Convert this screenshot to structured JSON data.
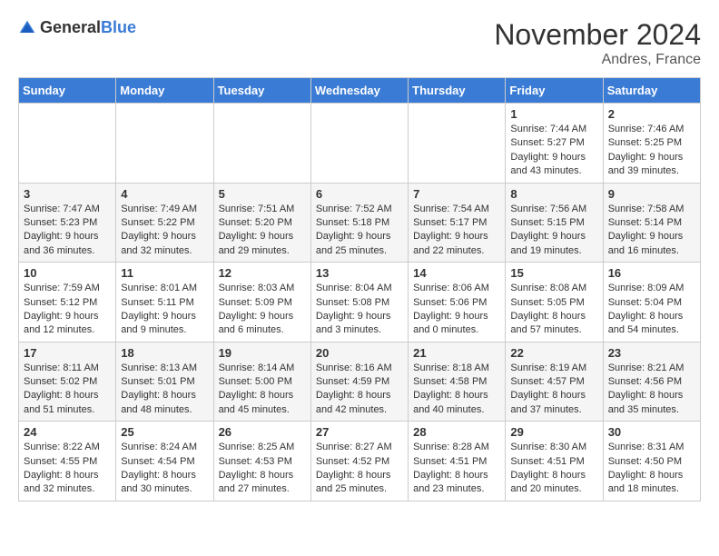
{
  "header": {
    "logo_general": "General",
    "logo_blue": "Blue",
    "month": "November 2024",
    "location": "Andres, France"
  },
  "days_of_week": [
    "Sunday",
    "Monday",
    "Tuesday",
    "Wednesday",
    "Thursday",
    "Friday",
    "Saturday"
  ],
  "weeks": [
    [
      {
        "day": "",
        "info": ""
      },
      {
        "day": "",
        "info": ""
      },
      {
        "day": "",
        "info": ""
      },
      {
        "day": "",
        "info": ""
      },
      {
        "day": "",
        "info": ""
      },
      {
        "day": "1",
        "info": "Sunrise: 7:44 AM\nSunset: 5:27 PM\nDaylight: 9 hours and 43 minutes."
      },
      {
        "day": "2",
        "info": "Sunrise: 7:46 AM\nSunset: 5:25 PM\nDaylight: 9 hours and 39 minutes."
      }
    ],
    [
      {
        "day": "3",
        "info": "Sunrise: 7:47 AM\nSunset: 5:23 PM\nDaylight: 9 hours and 36 minutes."
      },
      {
        "day": "4",
        "info": "Sunrise: 7:49 AM\nSunset: 5:22 PM\nDaylight: 9 hours and 32 minutes."
      },
      {
        "day": "5",
        "info": "Sunrise: 7:51 AM\nSunset: 5:20 PM\nDaylight: 9 hours and 29 minutes."
      },
      {
        "day": "6",
        "info": "Sunrise: 7:52 AM\nSunset: 5:18 PM\nDaylight: 9 hours and 25 minutes."
      },
      {
        "day": "7",
        "info": "Sunrise: 7:54 AM\nSunset: 5:17 PM\nDaylight: 9 hours and 22 minutes."
      },
      {
        "day": "8",
        "info": "Sunrise: 7:56 AM\nSunset: 5:15 PM\nDaylight: 9 hours and 19 minutes."
      },
      {
        "day": "9",
        "info": "Sunrise: 7:58 AM\nSunset: 5:14 PM\nDaylight: 9 hours and 16 minutes."
      }
    ],
    [
      {
        "day": "10",
        "info": "Sunrise: 7:59 AM\nSunset: 5:12 PM\nDaylight: 9 hours and 12 minutes."
      },
      {
        "day": "11",
        "info": "Sunrise: 8:01 AM\nSunset: 5:11 PM\nDaylight: 9 hours and 9 minutes."
      },
      {
        "day": "12",
        "info": "Sunrise: 8:03 AM\nSunset: 5:09 PM\nDaylight: 9 hours and 6 minutes."
      },
      {
        "day": "13",
        "info": "Sunrise: 8:04 AM\nSunset: 5:08 PM\nDaylight: 9 hours and 3 minutes."
      },
      {
        "day": "14",
        "info": "Sunrise: 8:06 AM\nSunset: 5:06 PM\nDaylight: 9 hours and 0 minutes."
      },
      {
        "day": "15",
        "info": "Sunrise: 8:08 AM\nSunset: 5:05 PM\nDaylight: 8 hours and 57 minutes."
      },
      {
        "day": "16",
        "info": "Sunrise: 8:09 AM\nSunset: 5:04 PM\nDaylight: 8 hours and 54 minutes."
      }
    ],
    [
      {
        "day": "17",
        "info": "Sunrise: 8:11 AM\nSunset: 5:02 PM\nDaylight: 8 hours and 51 minutes."
      },
      {
        "day": "18",
        "info": "Sunrise: 8:13 AM\nSunset: 5:01 PM\nDaylight: 8 hours and 48 minutes."
      },
      {
        "day": "19",
        "info": "Sunrise: 8:14 AM\nSunset: 5:00 PM\nDaylight: 8 hours and 45 minutes."
      },
      {
        "day": "20",
        "info": "Sunrise: 8:16 AM\nSunset: 4:59 PM\nDaylight: 8 hours and 42 minutes."
      },
      {
        "day": "21",
        "info": "Sunrise: 8:18 AM\nSunset: 4:58 PM\nDaylight: 8 hours and 40 minutes."
      },
      {
        "day": "22",
        "info": "Sunrise: 8:19 AM\nSunset: 4:57 PM\nDaylight: 8 hours and 37 minutes."
      },
      {
        "day": "23",
        "info": "Sunrise: 8:21 AM\nSunset: 4:56 PM\nDaylight: 8 hours and 35 minutes."
      }
    ],
    [
      {
        "day": "24",
        "info": "Sunrise: 8:22 AM\nSunset: 4:55 PM\nDaylight: 8 hours and 32 minutes."
      },
      {
        "day": "25",
        "info": "Sunrise: 8:24 AM\nSunset: 4:54 PM\nDaylight: 8 hours and 30 minutes."
      },
      {
        "day": "26",
        "info": "Sunrise: 8:25 AM\nSunset: 4:53 PM\nDaylight: 8 hours and 27 minutes."
      },
      {
        "day": "27",
        "info": "Sunrise: 8:27 AM\nSunset: 4:52 PM\nDaylight: 8 hours and 25 minutes."
      },
      {
        "day": "28",
        "info": "Sunrise: 8:28 AM\nSunset: 4:51 PM\nDaylight: 8 hours and 23 minutes."
      },
      {
        "day": "29",
        "info": "Sunrise: 8:30 AM\nSunset: 4:51 PM\nDaylight: 8 hours and 20 minutes."
      },
      {
        "day": "30",
        "info": "Sunrise: 8:31 AM\nSunset: 4:50 PM\nDaylight: 8 hours and 18 minutes."
      }
    ]
  ]
}
